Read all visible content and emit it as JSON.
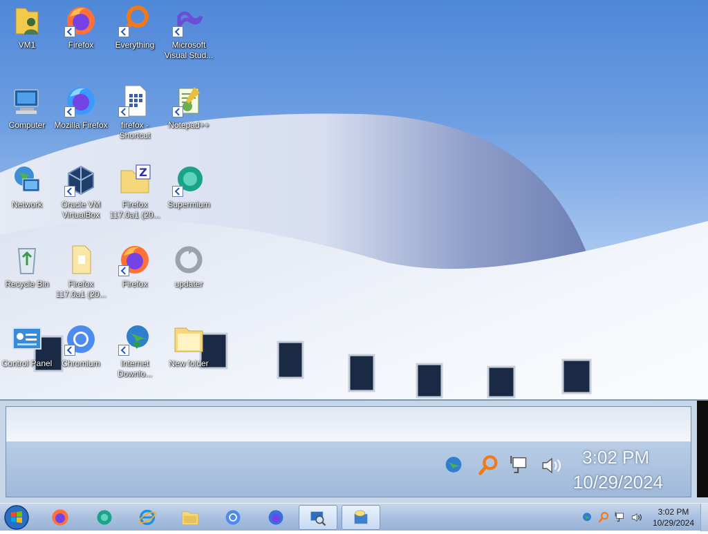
{
  "desktop_icons": [
    {
      "label": "VM1",
      "icon": "user-folder-icon",
      "shortcut": false
    },
    {
      "label": "Firefox",
      "icon": "firefox-icon",
      "shortcut": true
    },
    {
      "label": "Everything",
      "icon": "everything-search-icon",
      "shortcut": true
    },
    {
      "label": "Microsoft Visual Stud...",
      "icon": "visual-studio-icon",
      "shortcut": true
    },
    {
      "label": "Computer",
      "icon": "computer-icon",
      "shortcut": false
    },
    {
      "label": "Mozilla Firefox",
      "icon": "firefox-icon",
      "shortcut": true
    },
    {
      "label": "firefox - Shortcut",
      "icon": "file-shortcut-icon",
      "shortcut": true
    },
    {
      "label": "Notepad++",
      "icon": "notepadpp-icon",
      "shortcut": true
    },
    {
      "label": "Network",
      "icon": "network-icon",
      "shortcut": false
    },
    {
      "label": "Oracle VM VirtualBox",
      "icon": "virtualbox-icon",
      "shortcut": true
    },
    {
      "label": "Firefox 117.0a1 (20...",
      "icon": "zip-folder-icon",
      "shortcut": false
    },
    {
      "label": "Supermium",
      "icon": "supermium-icon",
      "shortcut": true
    },
    {
      "label": "Recycle Bin",
      "icon": "recycle-bin-icon",
      "shortcut": false
    },
    {
      "label": "Firefox 117.0a1 (20...",
      "icon": "folder-icon",
      "shortcut": false
    },
    {
      "label": "Firefox",
      "icon": "firefox-icon",
      "shortcut": true
    },
    {
      "label": "updater",
      "icon": "updater-icon",
      "shortcut": false
    },
    {
      "label": "Control Panel",
      "icon": "control-panel-icon",
      "shortcut": false
    },
    {
      "label": "Chromium",
      "icon": "chromium-icon",
      "shortcut": true
    },
    {
      "label": "Internet Downlo...",
      "icon": "idm-icon",
      "shortcut": true
    },
    {
      "label": "New folder",
      "icon": "folder-icon",
      "shortcut": false
    }
  ],
  "magnifier": {
    "time": "3:02 PM",
    "date": "10/29/2024"
  },
  "taskbar": {
    "start_icon": "windows-start-orb-icon",
    "pinned": [
      {
        "icon": "firefox-icon",
        "active": false
      },
      {
        "icon": "supermium-icon",
        "active": false
      },
      {
        "icon": "internet-explorer-icon",
        "active": false
      },
      {
        "icon": "file-explorer-icon",
        "active": false
      },
      {
        "icon": "chromium-icon",
        "active": false
      },
      {
        "icon": "firefox-nightly-icon",
        "active": false
      },
      {
        "icon": "magnifier-icon",
        "active": true
      },
      {
        "icon": "snipping-tool-icon",
        "active": true
      }
    ],
    "tray": [
      "idm-tray-icon",
      "everything-tray-icon",
      "network-tray-icon",
      "volume-icon"
    ],
    "clock": {
      "time": "3:02 PM",
      "date": "10/29/2024"
    }
  },
  "colors": {
    "sky_top": "#4f87d8",
    "building": "#eef2f9",
    "taskbar": "#a9c0df",
    "firefox_orange": "#ff7139",
    "firefox_purple": "#7542e5"
  }
}
